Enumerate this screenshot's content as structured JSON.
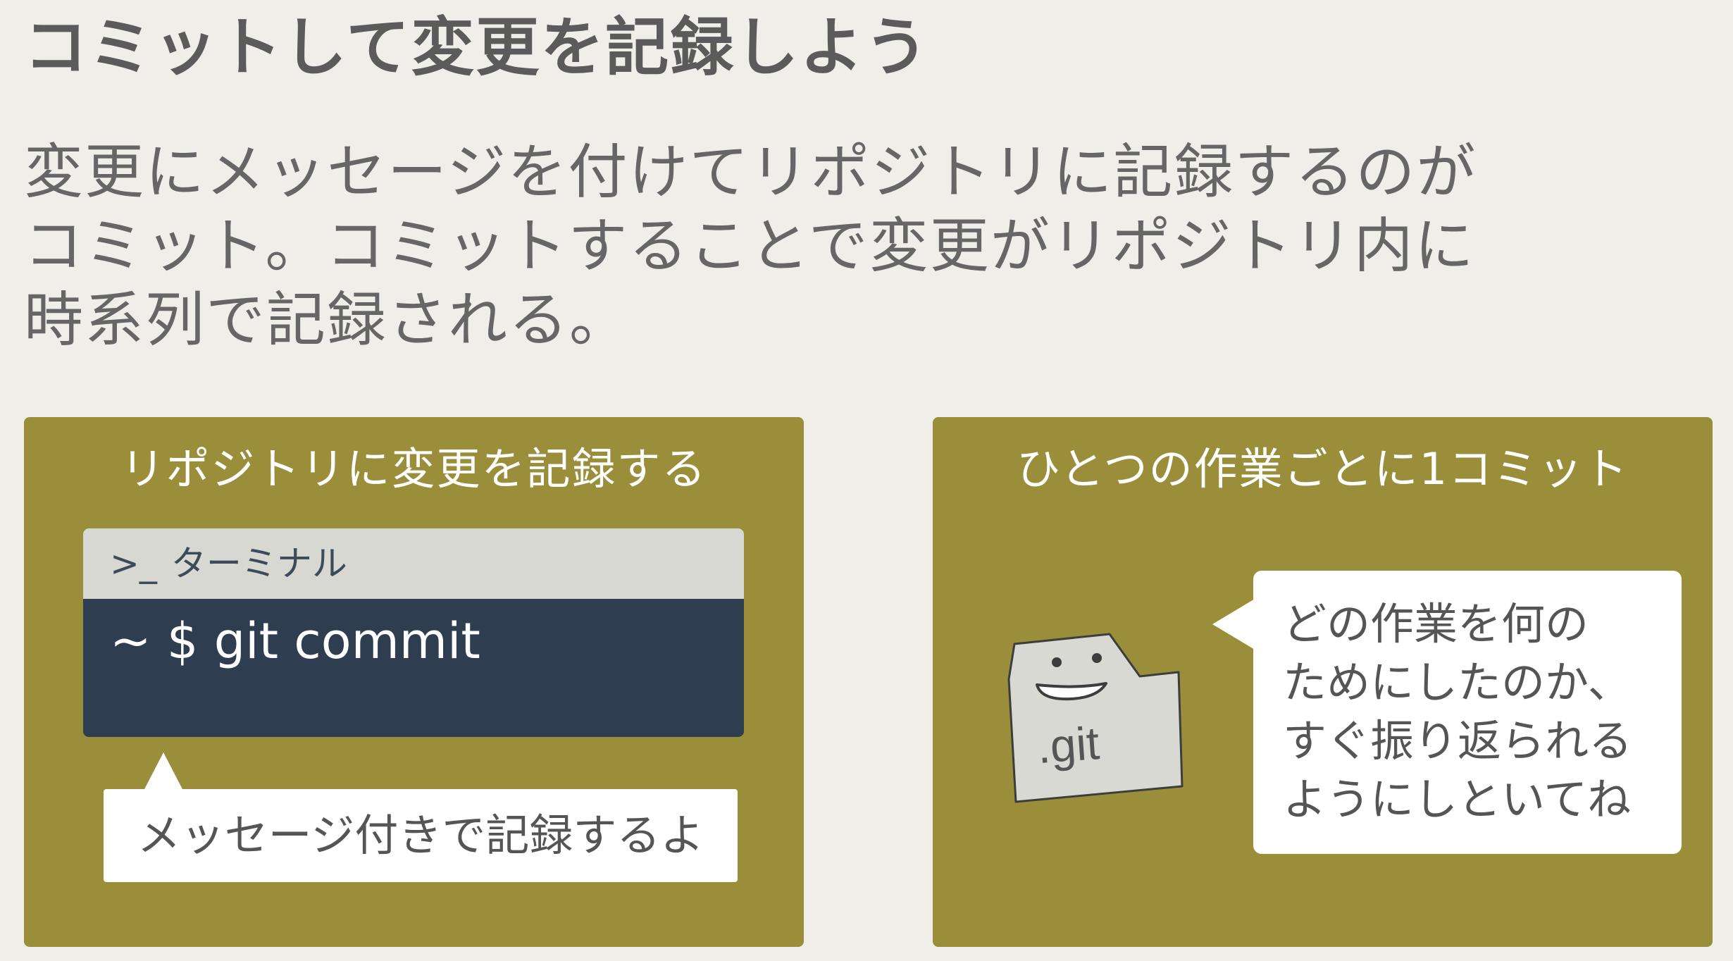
{
  "title": "コミットして変更を記録しよう",
  "description": [
    "変更にメッセージを付けてリポジトリに記録するのが",
    "コミット。コミットすることで変更がリポジトリ内に",
    "時系列で記録される。"
  ],
  "left_panel": {
    "heading": "リポジトリに変更を記録する",
    "terminal": {
      "prompt_icon": ">_",
      "title": "ターミナル",
      "command": "~ $ git commit"
    },
    "callout": "メッセージ付きで記録するよ"
  },
  "right_panel": {
    "heading": "ひとつの作業ごとに1コミット",
    "mascot": {
      "icon": "git-folder-icon",
      "label": ".git"
    },
    "callout_lines": [
      "どの作業を何の",
      "ためにしたのか、",
      "すぐ振り返られる",
      "ようにしといてね"
    ]
  },
  "colors": {
    "background": "#efeee8",
    "panel": "#9a8e3a",
    "terminal_bar": "#d8d8d2",
    "terminal_body": "#2e3d4f",
    "mascot_fill": "#d9d9d3"
  }
}
